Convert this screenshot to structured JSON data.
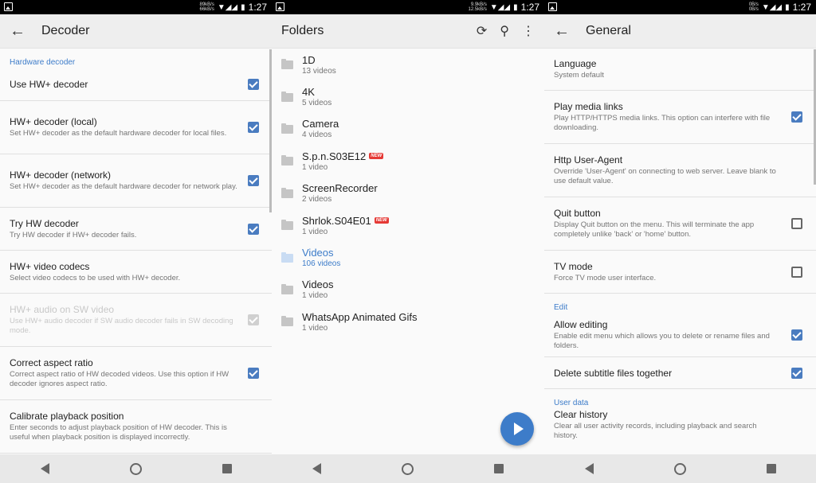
{
  "status_bars": [
    {
      "speed_top": "89kB/s",
      "speed_bottom": "66kB/s",
      "time": "1:27"
    },
    {
      "speed_top": "9.9kB/s",
      "speed_bottom": "12.5kB/s",
      "time": "1:27"
    },
    {
      "speed_top": "0B/s",
      "speed_bottom": "0B/s",
      "time": "1:27"
    }
  ],
  "decoder": {
    "title": "Decoder",
    "section": "Hardware decoder",
    "items": [
      {
        "title": "Use HW+ decoder",
        "summary": "",
        "state": "on"
      },
      {
        "title": "HW+ decoder (local)",
        "summary": "Set HW+ decoder as the default hardware decoder for local files.",
        "state": "on"
      },
      {
        "title": "HW+ decoder (network)",
        "summary": "Set HW+ decoder as the default hardware decoder for network play.",
        "state": "on"
      },
      {
        "title": "Try HW decoder",
        "summary": "Try HW decoder if HW+ decoder fails.",
        "state": "on"
      },
      {
        "title": "HW+ video codecs",
        "summary": "Select video codecs to be used with HW+ decoder.",
        "state": "none"
      },
      {
        "title": "HW+ audio on SW video",
        "summary": "Use HW+ audio decoder if SW audio decoder fails in SW decoding mode.",
        "state": "disabled"
      },
      {
        "title": "Correct aspect ratio",
        "summary": "Correct aspect ratio of HW decoded videos. Use this option if HW decoder ignores aspect ratio.",
        "state": "on"
      },
      {
        "title": "Calibrate playback position",
        "summary": "Enter seconds to adjust playback position of HW decoder. This is useful when playback position is displayed incorrectly.",
        "state": "none"
      }
    ]
  },
  "folders": {
    "title": "Folders",
    "new_badge": "NEW",
    "items": [
      {
        "name": "1D",
        "count": "13 videos",
        "is_new": false,
        "selected": false
      },
      {
        "name": "4K",
        "count": "5 videos",
        "is_new": false,
        "selected": false
      },
      {
        "name": "Camera",
        "count": "4 videos",
        "is_new": false,
        "selected": false
      },
      {
        "name": "S.p.n.S03E12",
        "count": "1 video",
        "is_new": true,
        "selected": false
      },
      {
        "name": "ScreenRecorder",
        "count": "2 videos",
        "is_new": false,
        "selected": false
      },
      {
        "name": "Shrlok.S04E01",
        "count": "1 video",
        "is_new": true,
        "selected": false
      },
      {
        "name": "Videos",
        "count": "106 videos",
        "is_new": false,
        "selected": true
      },
      {
        "name": "Videos",
        "count": "1 video",
        "is_new": false,
        "selected": false
      },
      {
        "name": "WhatsApp Animated Gifs",
        "count": "1 video",
        "is_new": false,
        "selected": false
      }
    ]
  },
  "general": {
    "title": "General",
    "rows": [
      {
        "kind": "pref",
        "title": "Language",
        "summary": "System default",
        "state": "none",
        "h": 53
      },
      {
        "kind": "pref",
        "title": "Play media links",
        "summary": "Play HTTP/HTTPS media links. This option can interfere with file downloading.",
        "state": "on",
        "h": 67
      },
      {
        "kind": "pref",
        "title": "Http User-Agent",
        "summary": "Override 'User-Agent' on connecting to web server. Leave blank to use default value.",
        "state": "none",
        "h": 67
      },
      {
        "kind": "pref",
        "title": "Quit button",
        "summary": "Display Quit button on the menu. This will terminate the app completely unlike 'back' or 'home' button.",
        "state": "off",
        "h": 67
      },
      {
        "kind": "pref",
        "title": "TV mode",
        "summary": "Force TV mode user interface.",
        "state": "off",
        "h": 54
      },
      {
        "kind": "section",
        "title": "Edit"
      },
      {
        "kind": "pref",
        "title": "Allow editing",
        "summary": "Enable edit menu which allows you to delete or rename files and folders.",
        "state": "on",
        "h": 55
      },
      {
        "kind": "pref",
        "title": "Delete subtitle files together",
        "summary": "",
        "state": "on",
        "h": 40
      },
      {
        "kind": "section",
        "title": "User data"
      },
      {
        "kind": "pref",
        "title": "Clear history",
        "summary": "Clear all user activity records, including playback and search history.",
        "state": "none",
        "h": 40
      }
    ]
  }
}
